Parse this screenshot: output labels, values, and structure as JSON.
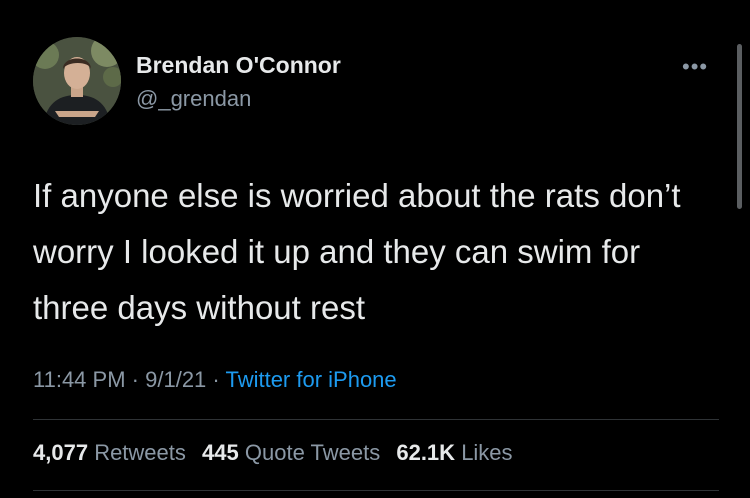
{
  "author": {
    "name": "Brendan O'Connor",
    "handle": "@_grendan"
  },
  "tweet": {
    "text": "If anyone else is worried about the rats don’t worry I looked it up and they can swim for three days without rest",
    "time": "11:44 PM",
    "date": "9/1/21",
    "separator": "·",
    "source": "Twitter for iPhone"
  },
  "stats": {
    "retweets": {
      "count": "4,077",
      "label": "Retweets"
    },
    "quote_tweets": {
      "count": "445",
      "label": "Quote Tweets"
    },
    "likes": {
      "count": "62.1K",
      "label": "Likes"
    }
  },
  "more_icon": "more-horizontal-icon",
  "colors": {
    "background": "#000000",
    "text_primary": "#e7e9ea",
    "text_secondary": "#8b98a5",
    "link": "#1d9bf0",
    "divider": "#2f3336"
  }
}
